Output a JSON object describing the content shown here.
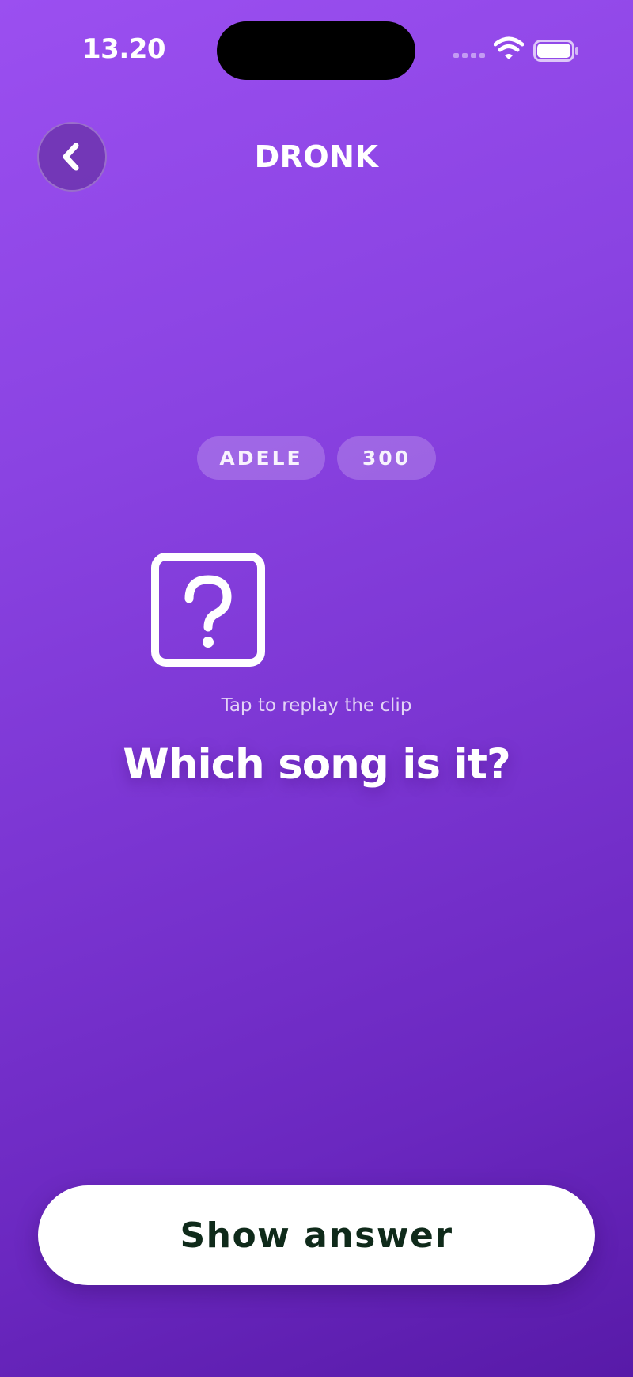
{
  "status_bar": {
    "time": "13.20",
    "icons": [
      "signal-icon",
      "wifi-icon",
      "battery-icon"
    ]
  },
  "header": {
    "title": "DRONK",
    "back_icon": "chevron-left-icon"
  },
  "chips": {
    "artist": "ADELE",
    "points": "300"
  },
  "replay": {
    "icon": "question-square-icon",
    "hint": "Tap to replay the clip"
  },
  "question": "Which song is it?",
  "actions": {
    "show_answer": "Show answer"
  },
  "colors": {
    "background_top": "#9b4ff0",
    "background_bottom": "#581aa8",
    "button_background": "#ffffff",
    "button_text": "#0f2a1a"
  }
}
